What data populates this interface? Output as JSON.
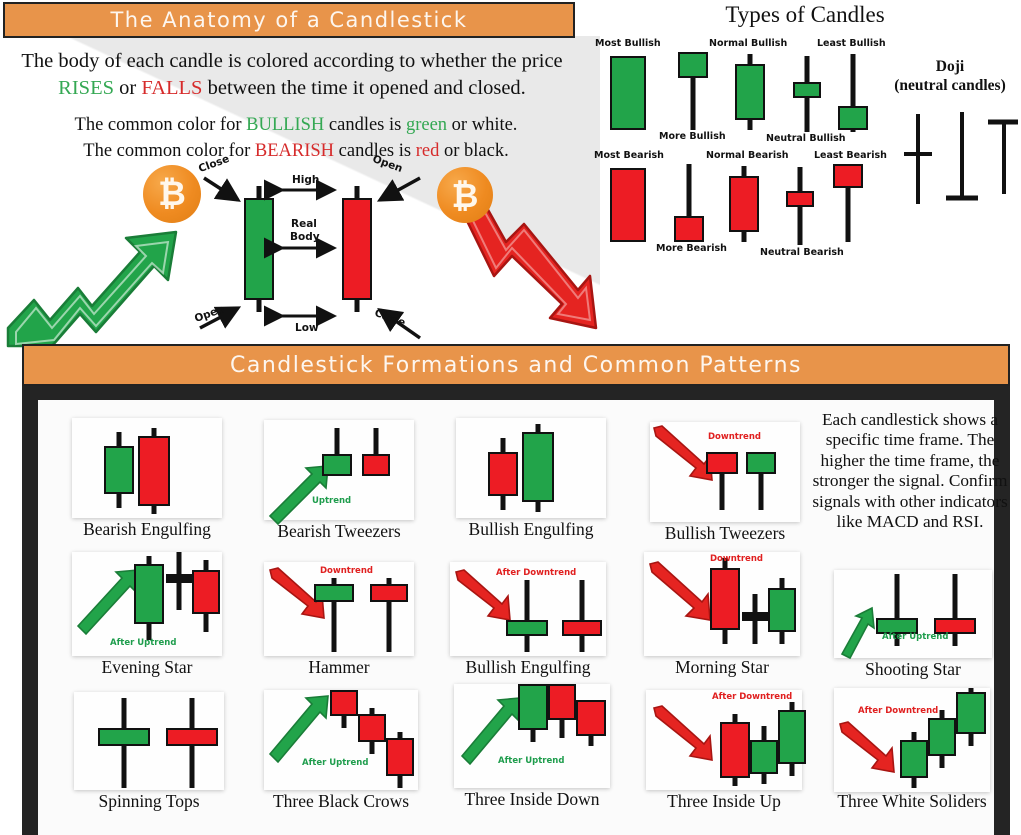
{
  "banners": {
    "top": "The Anatomy of a Candlestick",
    "bottom": "Candlestick Formations and Common Patterns"
  },
  "intro": {
    "line1_a": "The body of each candle is colored according to whether the price",
    "line1_rises": "RISES",
    "line1_or": " or ",
    "line1_falls": "FALLS",
    "line1_b": " between the time it opened and closed.",
    "line2_a": "The common color for ",
    "line2_bullish": "BULLISH",
    "line2_b": " candles is ",
    "line2_green": "green",
    "line2_c": " or white.",
    "line3_a": "The common color for ",
    "line3_bearish": "BEARISH",
    "line3_b": " candles is ",
    "line3_red": "red",
    "line3_c": " or black."
  },
  "anatomy": {
    "close_left": "Close",
    "open_right": "Open",
    "high": "High",
    "real_body_1": "Real",
    "real_body_2": "Body",
    "open_left": "Open",
    "close_right": "Close",
    "low": "Low"
  },
  "types": {
    "title": "Types of Candles",
    "doji_title_1": "Doji",
    "doji_title_2": "(neutral candles)",
    "bullish": [
      {
        "label": "Most Bullish"
      },
      {
        "label": "More Bullish"
      },
      {
        "label": "Normal Bullish"
      },
      {
        "label": "Neutral Bullish"
      },
      {
        "label": "Least Bullish"
      }
    ],
    "bearish": [
      {
        "label": "Most Bearish"
      },
      {
        "label": "More Bearish"
      },
      {
        "label": "Normal Bearish"
      },
      {
        "label": "Neutral Bearish"
      },
      {
        "label": "Least Bearish"
      }
    ],
    "doji_kinds": [
      "cross-doji",
      "dragonfly-doji",
      "gravestone-doji"
    ]
  },
  "patterns": [
    {
      "name": "Bearish Engulfing",
      "trend": null
    },
    {
      "name": "Bearish Tweezers",
      "trend": "Uptrend"
    },
    {
      "name": "Bullish Engulfing",
      "trend": null
    },
    {
      "name": "Bullish Tweezers",
      "trend": "Downtrend"
    },
    {
      "name": "Evening Star",
      "trend": "After Uptrend"
    },
    {
      "name": "Hammer",
      "trend": "Downtrend"
    },
    {
      "name": "Bullish Engulfing",
      "trend": "After Downtrend"
    },
    {
      "name": "Morning Star",
      "trend": "Downtrend"
    },
    {
      "name": "Shooting Star",
      "trend": "After Uptrend"
    },
    {
      "name": "Spinning Tops",
      "trend": null
    },
    {
      "name": "Three Black Crows",
      "trend": "After Uptrend"
    },
    {
      "name": "Three Inside Down",
      "trend": "After Uptrend"
    },
    {
      "name": "Three Inside Up",
      "trend": "After Downtrend"
    },
    {
      "name": "Three White Soliders",
      "trend": "After Downtrend"
    }
  ],
  "info_text": "Each candlestick shows a specific time frame.  The higher the time frame, the stronger the signal. Confirm signals with other indicators like MACD and RSI.",
  "icons": {
    "bitcoin": "₿",
    "up_arrow": "bitcoin-uptrend-arrow",
    "down_arrow": "bitcoin-downtrend-arrow"
  },
  "colors": {
    "banner_orange": "#e8944a",
    "bullish_green": "#22a44a",
    "bearish_red": "#ed1c24",
    "panel_dark": "#242424",
    "bitcoin_orange": "#ef8b21"
  }
}
